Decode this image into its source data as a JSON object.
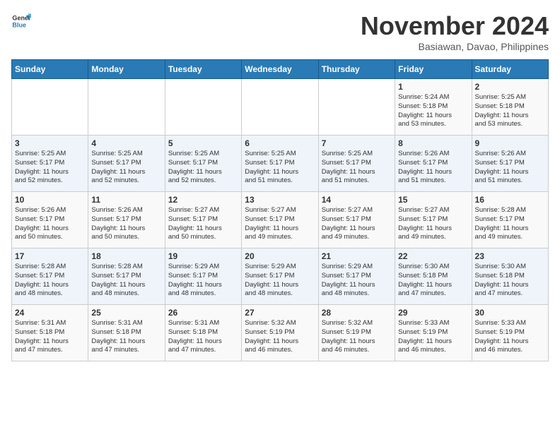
{
  "header": {
    "logo_general": "General",
    "logo_blue": "Blue",
    "title": "November 2024",
    "subtitle": "Basiawan, Davao, Philippines"
  },
  "weekdays": [
    "Sunday",
    "Monday",
    "Tuesday",
    "Wednesday",
    "Thursday",
    "Friday",
    "Saturday"
  ],
  "weeks": [
    [
      {
        "day": "",
        "info": ""
      },
      {
        "day": "",
        "info": ""
      },
      {
        "day": "",
        "info": ""
      },
      {
        "day": "",
        "info": ""
      },
      {
        "day": "",
        "info": ""
      },
      {
        "day": "1",
        "info": "Sunrise: 5:24 AM\nSunset: 5:18 PM\nDaylight: 11 hours\nand 53 minutes."
      },
      {
        "day": "2",
        "info": "Sunrise: 5:25 AM\nSunset: 5:18 PM\nDaylight: 11 hours\nand 53 minutes."
      }
    ],
    [
      {
        "day": "3",
        "info": "Sunrise: 5:25 AM\nSunset: 5:17 PM\nDaylight: 11 hours\nand 52 minutes."
      },
      {
        "day": "4",
        "info": "Sunrise: 5:25 AM\nSunset: 5:17 PM\nDaylight: 11 hours\nand 52 minutes."
      },
      {
        "day": "5",
        "info": "Sunrise: 5:25 AM\nSunset: 5:17 PM\nDaylight: 11 hours\nand 52 minutes."
      },
      {
        "day": "6",
        "info": "Sunrise: 5:25 AM\nSunset: 5:17 PM\nDaylight: 11 hours\nand 51 minutes."
      },
      {
        "day": "7",
        "info": "Sunrise: 5:25 AM\nSunset: 5:17 PM\nDaylight: 11 hours\nand 51 minutes."
      },
      {
        "day": "8",
        "info": "Sunrise: 5:26 AM\nSunset: 5:17 PM\nDaylight: 11 hours\nand 51 minutes."
      },
      {
        "day": "9",
        "info": "Sunrise: 5:26 AM\nSunset: 5:17 PM\nDaylight: 11 hours\nand 51 minutes."
      }
    ],
    [
      {
        "day": "10",
        "info": "Sunrise: 5:26 AM\nSunset: 5:17 PM\nDaylight: 11 hours\nand 50 minutes."
      },
      {
        "day": "11",
        "info": "Sunrise: 5:26 AM\nSunset: 5:17 PM\nDaylight: 11 hours\nand 50 minutes."
      },
      {
        "day": "12",
        "info": "Sunrise: 5:27 AM\nSunset: 5:17 PM\nDaylight: 11 hours\nand 50 minutes."
      },
      {
        "day": "13",
        "info": "Sunrise: 5:27 AM\nSunset: 5:17 PM\nDaylight: 11 hours\nand 49 minutes."
      },
      {
        "day": "14",
        "info": "Sunrise: 5:27 AM\nSunset: 5:17 PM\nDaylight: 11 hours\nand 49 minutes."
      },
      {
        "day": "15",
        "info": "Sunrise: 5:27 AM\nSunset: 5:17 PM\nDaylight: 11 hours\nand 49 minutes."
      },
      {
        "day": "16",
        "info": "Sunrise: 5:28 AM\nSunset: 5:17 PM\nDaylight: 11 hours\nand 49 minutes."
      }
    ],
    [
      {
        "day": "17",
        "info": "Sunrise: 5:28 AM\nSunset: 5:17 PM\nDaylight: 11 hours\nand 48 minutes."
      },
      {
        "day": "18",
        "info": "Sunrise: 5:28 AM\nSunset: 5:17 PM\nDaylight: 11 hours\nand 48 minutes."
      },
      {
        "day": "19",
        "info": "Sunrise: 5:29 AM\nSunset: 5:17 PM\nDaylight: 11 hours\nand 48 minutes."
      },
      {
        "day": "20",
        "info": "Sunrise: 5:29 AM\nSunset: 5:17 PM\nDaylight: 11 hours\nand 48 minutes."
      },
      {
        "day": "21",
        "info": "Sunrise: 5:29 AM\nSunset: 5:17 PM\nDaylight: 11 hours\nand 48 minutes."
      },
      {
        "day": "22",
        "info": "Sunrise: 5:30 AM\nSunset: 5:18 PM\nDaylight: 11 hours\nand 47 minutes."
      },
      {
        "day": "23",
        "info": "Sunrise: 5:30 AM\nSunset: 5:18 PM\nDaylight: 11 hours\nand 47 minutes."
      }
    ],
    [
      {
        "day": "24",
        "info": "Sunrise: 5:31 AM\nSunset: 5:18 PM\nDaylight: 11 hours\nand 47 minutes."
      },
      {
        "day": "25",
        "info": "Sunrise: 5:31 AM\nSunset: 5:18 PM\nDaylight: 11 hours\nand 47 minutes."
      },
      {
        "day": "26",
        "info": "Sunrise: 5:31 AM\nSunset: 5:18 PM\nDaylight: 11 hours\nand 47 minutes."
      },
      {
        "day": "27",
        "info": "Sunrise: 5:32 AM\nSunset: 5:19 PM\nDaylight: 11 hours\nand 46 minutes."
      },
      {
        "day": "28",
        "info": "Sunrise: 5:32 AM\nSunset: 5:19 PM\nDaylight: 11 hours\nand 46 minutes."
      },
      {
        "day": "29",
        "info": "Sunrise: 5:33 AM\nSunset: 5:19 PM\nDaylight: 11 hours\nand 46 minutes."
      },
      {
        "day": "30",
        "info": "Sunrise: 5:33 AM\nSunset: 5:19 PM\nDaylight: 11 hours\nand 46 minutes."
      }
    ]
  ]
}
